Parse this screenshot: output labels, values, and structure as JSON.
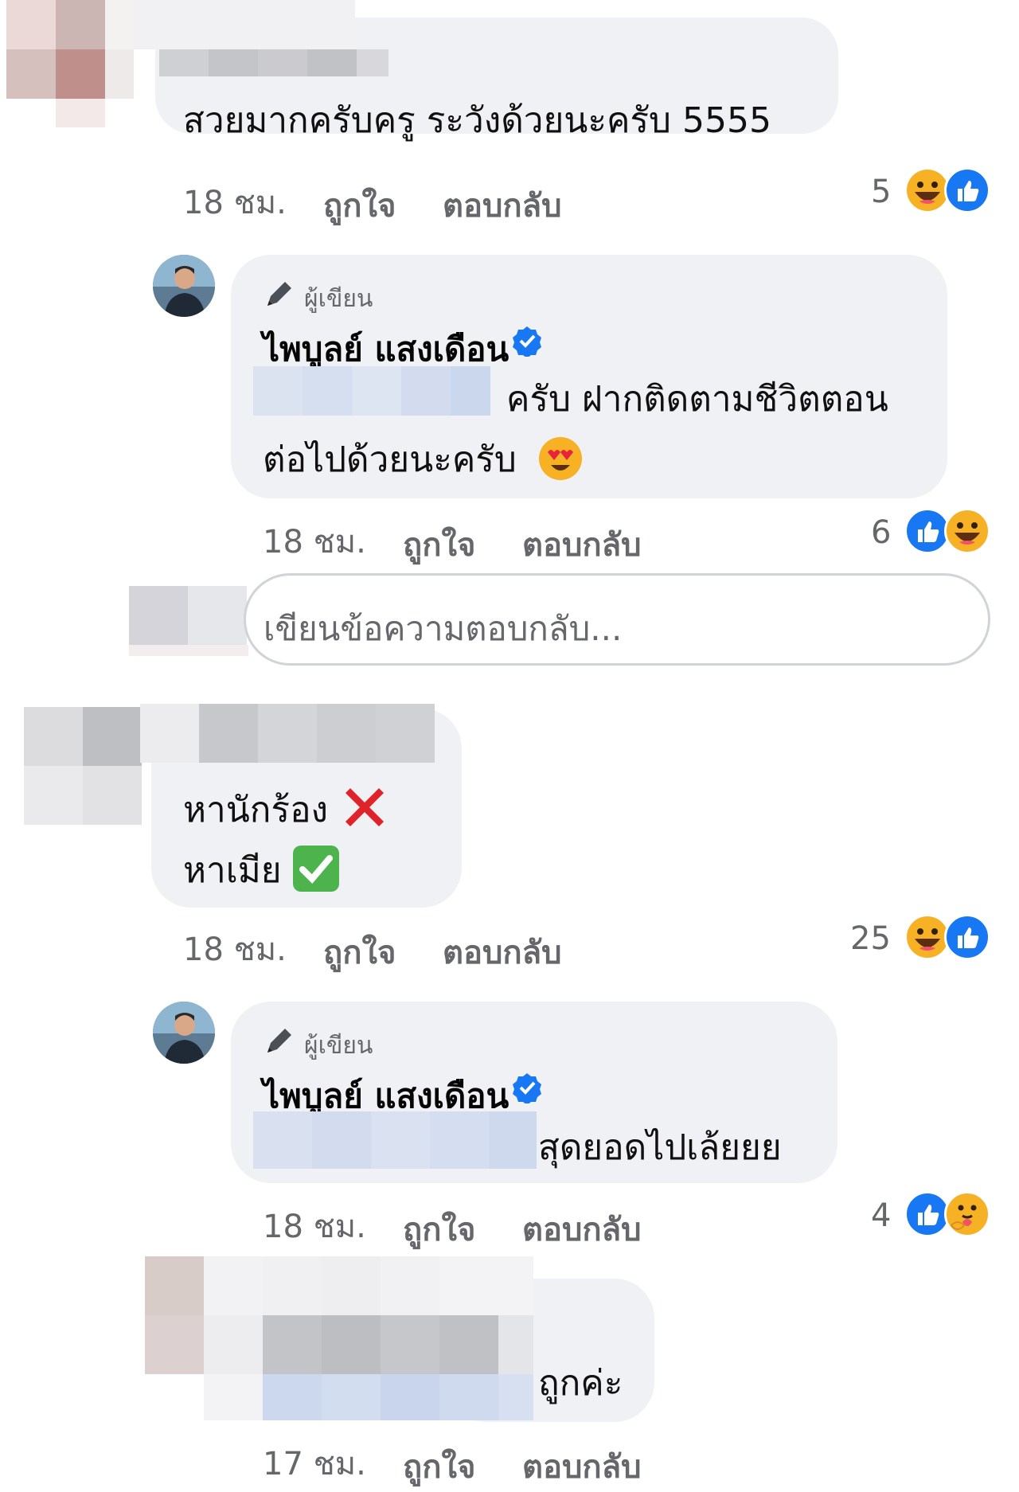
{
  "comments": [
    {
      "text": "สวยมากครับครู ระวังด้วยนะครับ 5555",
      "time": "18 ชม.",
      "like_label": "ถูกใจ",
      "reply_label": "ตอบกลับ",
      "reaction_count": "5",
      "reactions": [
        "haha-icon",
        "like-icon"
      ]
    },
    {
      "author_badge": "ผู้เขียน",
      "author": "ไพบูลย์ แสงเดือน",
      "text_line1": "ครับ ฝากติดตามชีวิตตอน",
      "text_line2": "ต่อไปด้วยนะครับ",
      "time": "18 ชม.",
      "like_label": "ถูกใจ",
      "reply_label": "ตอบกลับ",
      "reaction_count": "6",
      "reactions": [
        "like-icon",
        "haha-icon"
      ]
    },
    {
      "text_line1": "หานักร้อง",
      "text_line2": "หาเมีย",
      "time": "18 ชม.",
      "like_label": "ถูกใจ",
      "reply_label": "ตอบกลับ",
      "reaction_count": "25",
      "reactions": [
        "haha-icon",
        "like-icon"
      ]
    },
    {
      "author_badge": "ผู้เขียน",
      "author": "ไพบูลย์ แสงเดือน",
      "text": "สุดยอดไปเล้ยยย",
      "time": "18 ชม.",
      "like_label": "ถูกใจ",
      "reply_label": "ตอบกลับ",
      "reaction_count": "4",
      "reactions": [
        "like-icon",
        "care-icon"
      ]
    },
    {
      "text": "ถูกค่ะ",
      "time": "17 ชม.",
      "like_label": "ถูกใจ",
      "reply_label": "ตอบกลับ"
    }
  ],
  "reply_input": {
    "placeholder": "เขียนข้อความตอบกลับ..."
  },
  "colors": {
    "bubble": "#eff1f4",
    "meta": "#65676b",
    "like": "#1877f2",
    "haha": "#f7b125"
  }
}
